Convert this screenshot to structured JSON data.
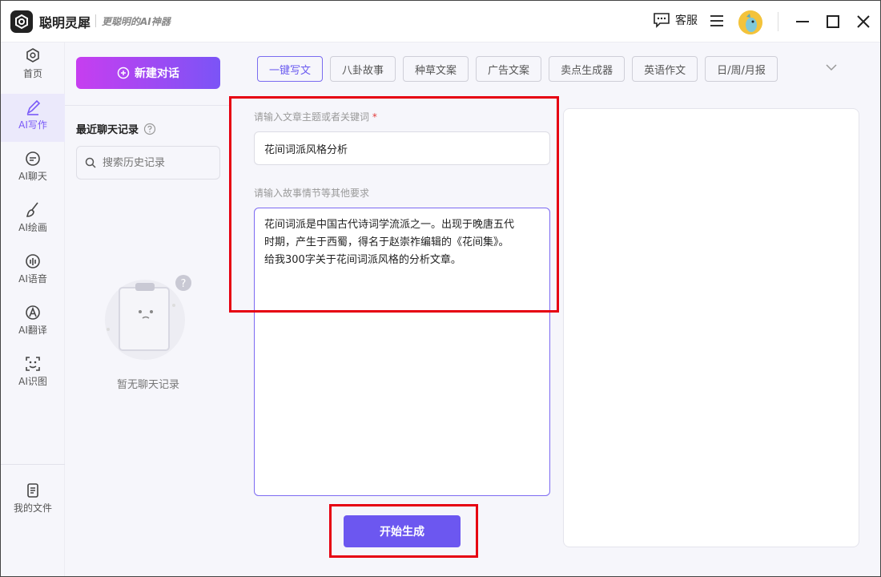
{
  "app": {
    "name": "聪明灵犀",
    "slogan": "更聪明的AI神器",
    "service_label": "客服"
  },
  "nav": {
    "items": [
      {
        "label": "首页",
        "icon": "home-icon"
      },
      {
        "label": "AI写作",
        "icon": "pen-icon"
      },
      {
        "label": "AI聊天",
        "icon": "chat-icon"
      },
      {
        "label": "AI绘画",
        "icon": "brush-icon"
      },
      {
        "label": "AI语音",
        "icon": "voice-icon"
      },
      {
        "label": "AI翻译",
        "icon": "translate-icon"
      },
      {
        "label": "AI识图",
        "icon": "image-recognize-icon"
      }
    ],
    "files_label": "我的文件",
    "active_index": 1
  },
  "sidebar": {
    "new_chat_label": "新建对话",
    "recent_title": "最近聊天记录",
    "search_placeholder": "搜索历史记录",
    "empty_text": "暂无聊天记录"
  },
  "main": {
    "tabs": [
      "一键写文",
      "八卦故事",
      "种草文案",
      "广告文案",
      "卖点生成器",
      "英语作文",
      "日/周/月报"
    ],
    "active_tab": 0,
    "topic_label": "请输入文章主题或者关键词",
    "required_mark": "*",
    "topic_value": "花间词派风格分析",
    "requirements_label": "请输入故事情节等其他要求",
    "requirements_lines": [
      "花间词派是中国古代诗词学流派之一。出现于晚唐五代",
      "时期，产生于西蜀，得名于赵崇祚编辑的《花间集》。",
      "给我300字关于花间词派风格的分析文章。"
    ],
    "generate_label": "开始生成"
  },
  "colors": {
    "accent": "#6c57f0",
    "gradient_start": "#c73ef0",
    "gradient_end": "#7b54f6",
    "annotation_red": "#e60012"
  }
}
